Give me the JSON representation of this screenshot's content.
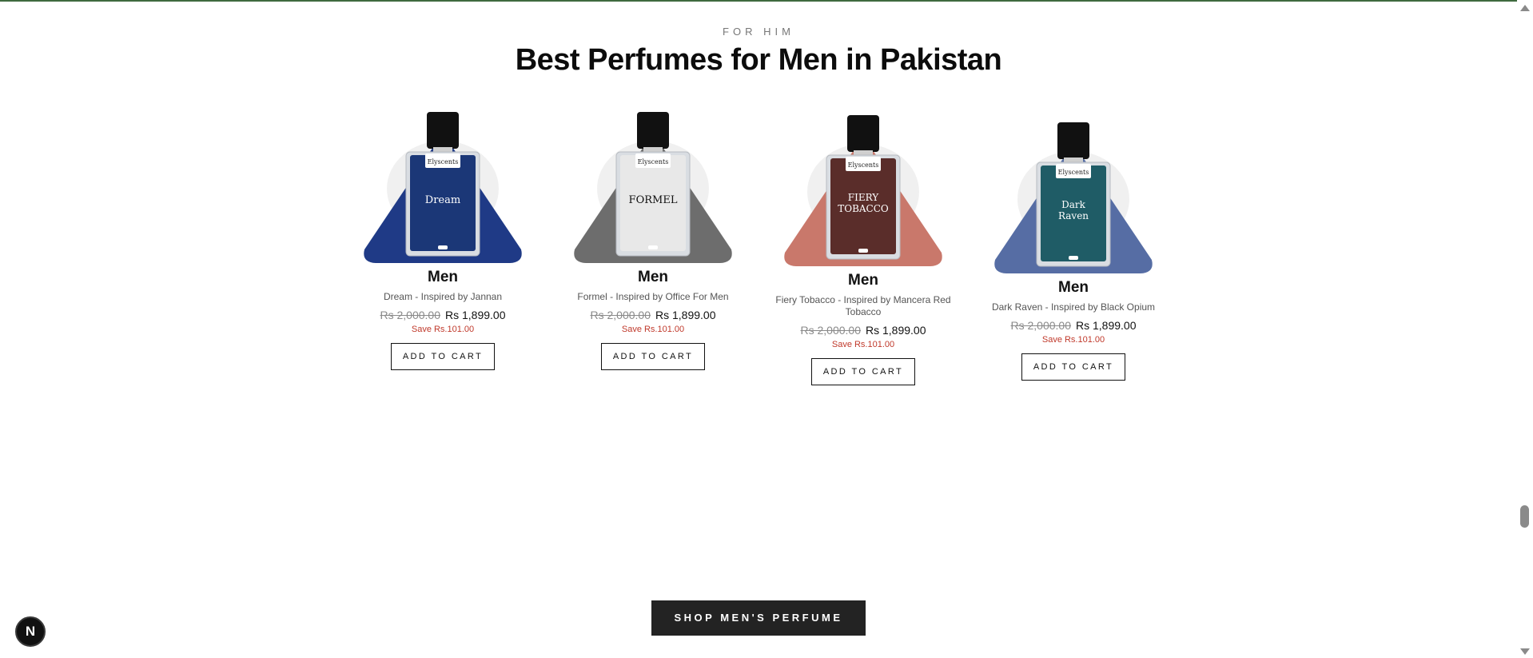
{
  "section": {
    "eyebrow": "FOR HIM",
    "heading": "Best Perfumes for Men in Pakistan",
    "shop_button": "SHOP MEN'S PERFUME"
  },
  "products": [
    {
      "category": "Men",
      "name": "Dream - Inspired by Jannan",
      "compare_price": "Rs 2,000.00",
      "price": "Rs 1,899.00",
      "save": "Save Rs.101.00",
      "button": "ADD TO CART",
      "brand": "Elyscents",
      "label_title": "Dream",
      "accent": "#1f3a86",
      "label_bg": "#1b3777"
    },
    {
      "category": "Men",
      "name": "Formel - Inspired by Office For Men",
      "compare_price": "Rs 2,000.00",
      "price": "Rs 1,899.00",
      "save": "Save Rs.101.00",
      "button": "ADD TO CART",
      "brand": "Elyscents",
      "label_title": "FORMEL",
      "accent": "#6d6d6d",
      "label_bg": "#e8e8e8"
    },
    {
      "category": "Men",
      "name": "Fiery Tobacco - Inspired by Mancera Red Tobacco",
      "compare_price": "Rs 2,000.00",
      "price": "Rs 1,899.00",
      "save": "Save Rs.101.00",
      "button": "ADD TO CART",
      "brand": "Elyscents",
      "label_title": "FIERY TOBACCO",
      "accent": "#c9786b",
      "label_bg": "#5a2d2a"
    },
    {
      "category": "Men",
      "name": "Dark Raven - Inspired by Black Opium",
      "compare_price": "Rs 2,000.00",
      "price": "Rs 1,899.00",
      "save": "Save Rs.101.00",
      "button": "ADD TO CART",
      "brand": "Elyscents",
      "label_title": "Dark Raven",
      "accent": "#566da4",
      "label_bg": "#1f5c66"
    }
  ],
  "badge": {
    "letter": "N"
  },
  "colors": {
    "sale_red": "#c0392b",
    "button_dark": "#232323"
  }
}
